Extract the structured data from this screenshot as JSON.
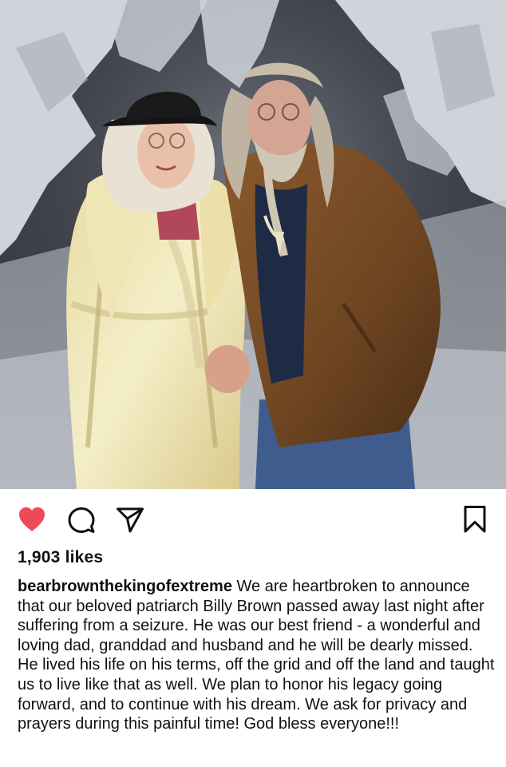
{
  "post": {
    "photo": {
      "description_icon": "photo-couple-in-snow"
    },
    "actions": {
      "like_icon": "heart-filled-icon",
      "comment_icon": "comment-icon",
      "share_icon": "share-icon",
      "save_icon": "bookmark-icon",
      "liked": true,
      "like_color": "#ed4956"
    },
    "likes_text": "1,903 likes",
    "caption": {
      "username": "bearbrownthekingofextreme",
      "text": "We are heartbroken to announce that our beloved patriarch Billy Brown passed away last night after suffering from a seizure. He was our best friend - a wonderful and loving dad, granddad and husband and he will be dearly missed.  He lived his life on his terms, off the grid and off the land and taught us to live like that as well. We plan to honor his legacy going forward, and to continue with his dream.  We ask for privacy and prayers during this painful time! God bless everyone!!!"
    }
  }
}
